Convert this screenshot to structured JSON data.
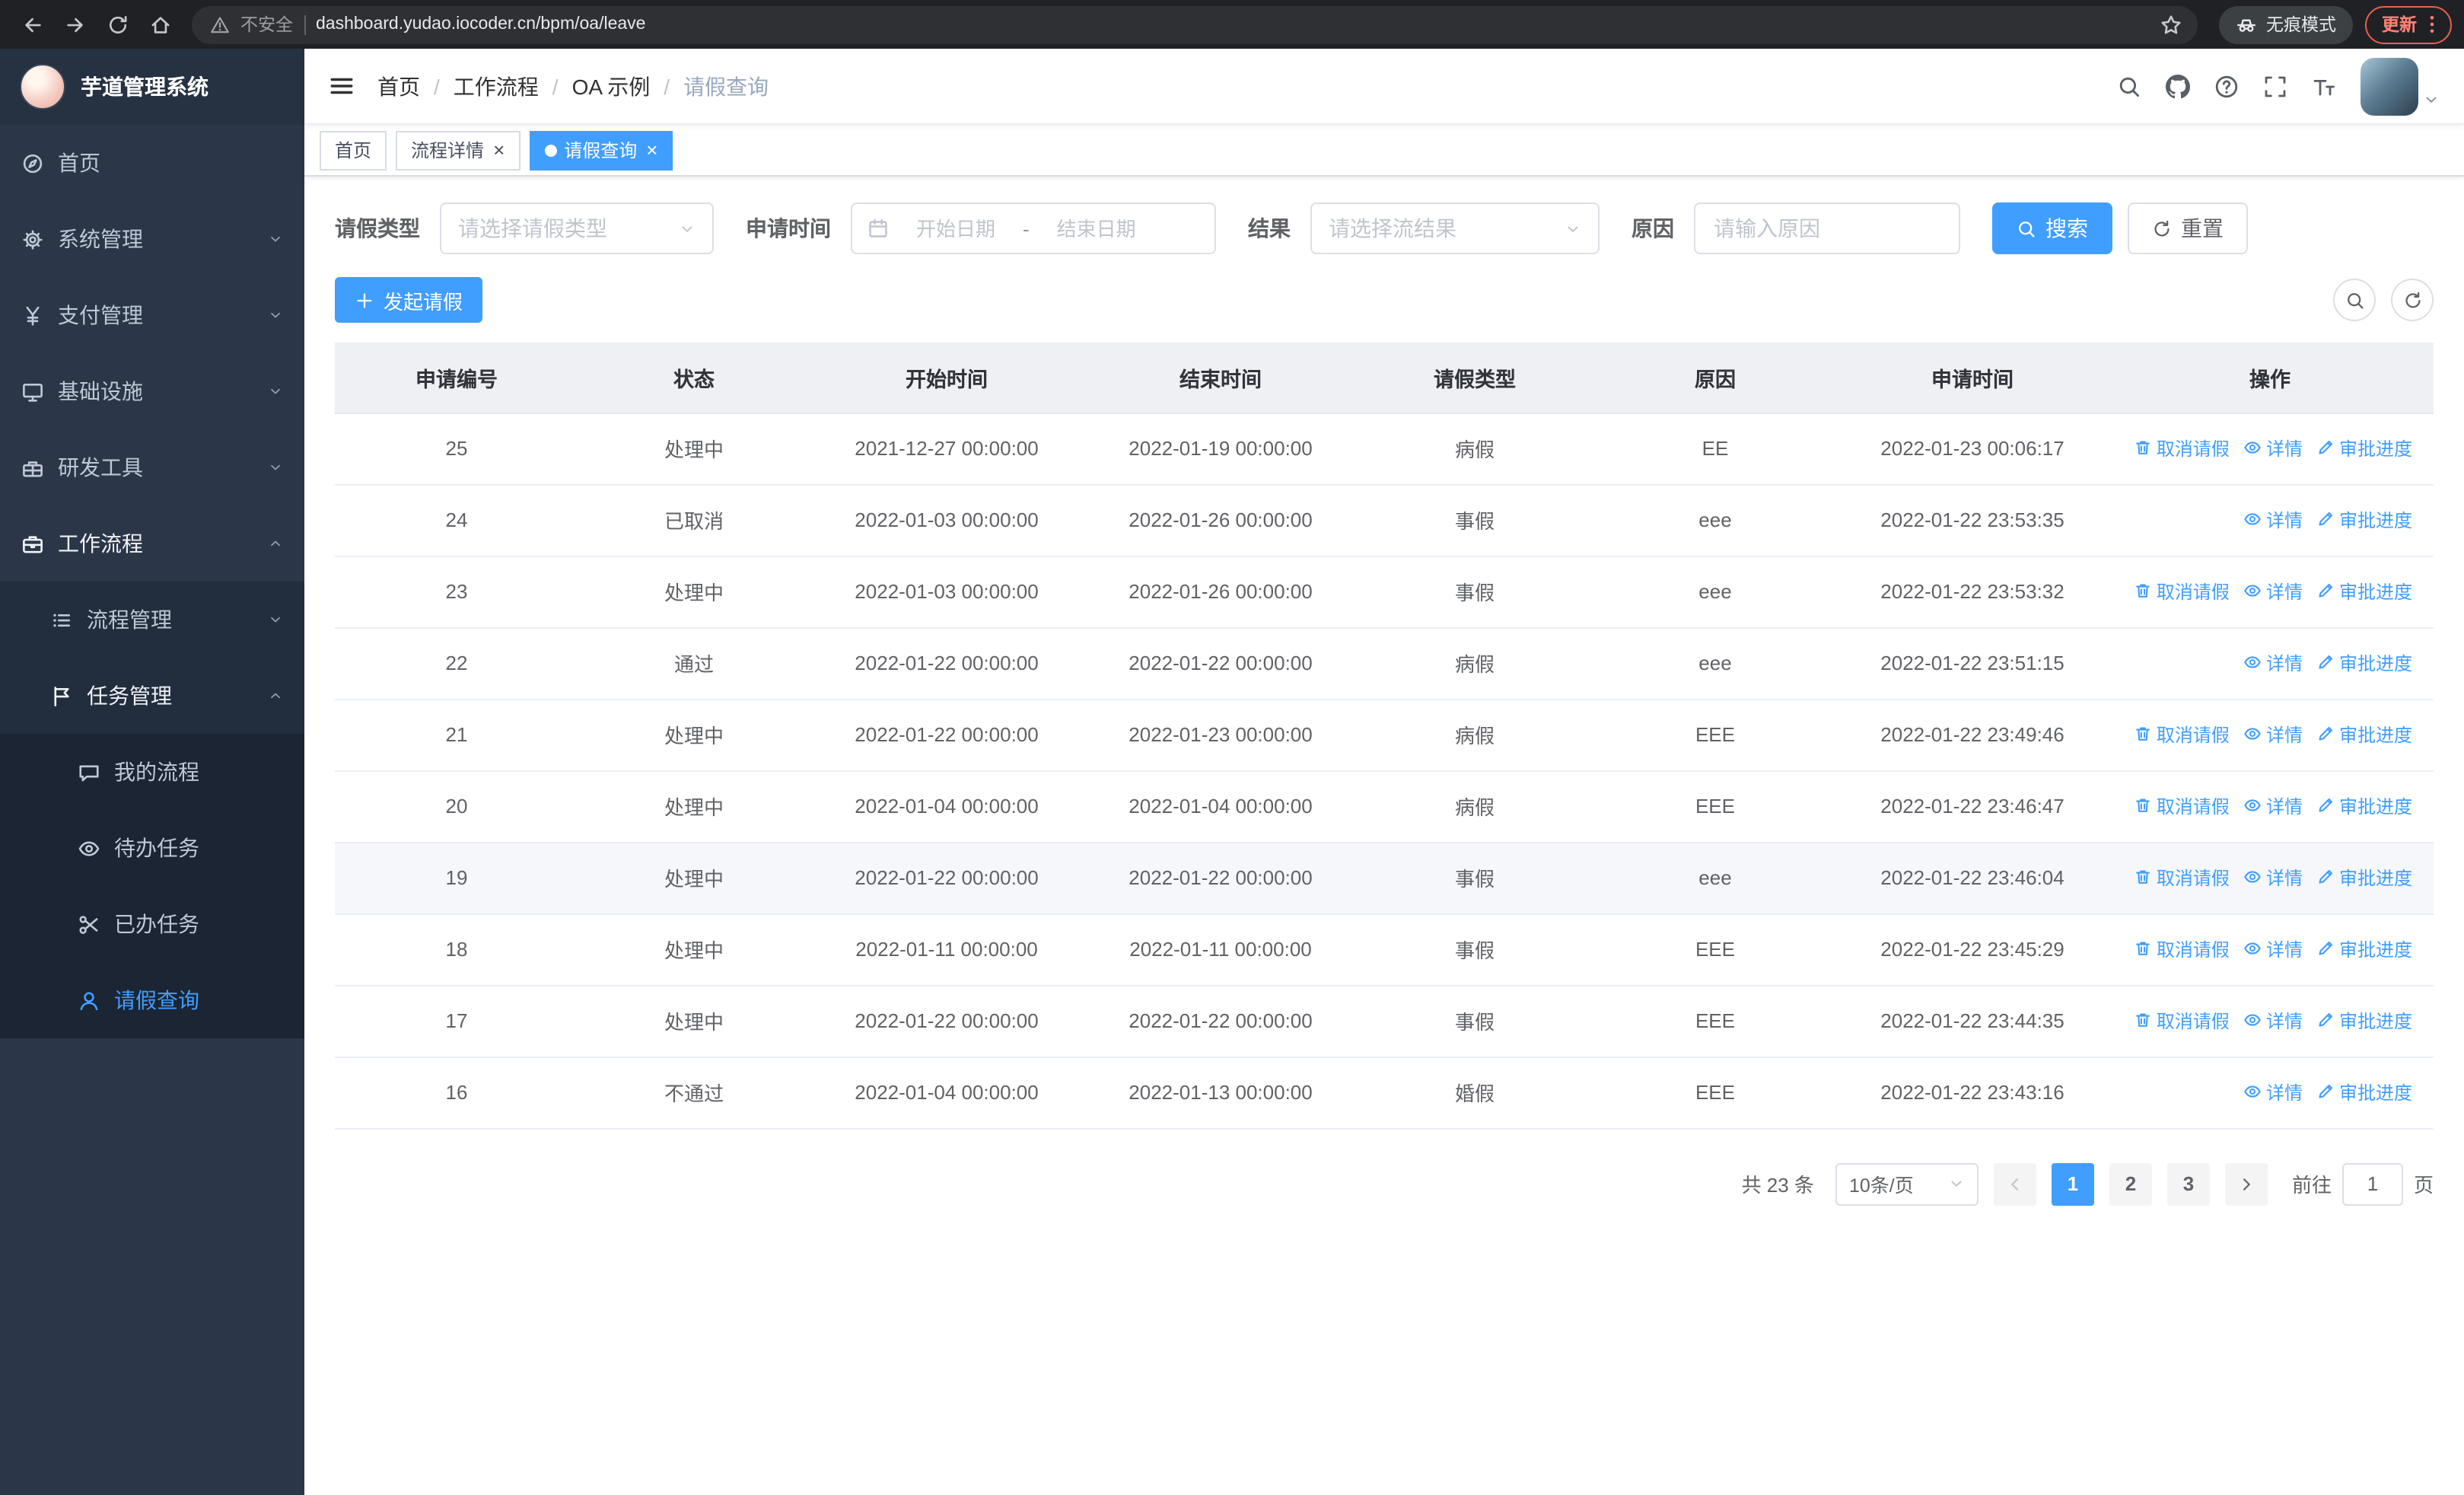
{
  "colors": {
    "accent": "#409eff",
    "sidebar_bg": "#2b3648",
    "table_header_bg": "#eef0f4"
  },
  "browser": {
    "security_label": "不安全",
    "url": "dashboard.yudao.iocoder.cn/bpm/oa/leave",
    "incognito_label": "无痕模式",
    "update_label": "更新"
  },
  "sidebar": {
    "logo_title": "芋道管理系统",
    "items": [
      {
        "label": "首页",
        "icon": "dashboard-icon",
        "level": 1
      },
      {
        "label": "系统管理",
        "icon": "gear-icon",
        "level": 1,
        "chevron": "down"
      },
      {
        "label": "支付管理",
        "icon": "yen-icon",
        "level": 1,
        "chevron": "down"
      },
      {
        "label": "基础设施",
        "icon": "monitor-icon",
        "level": 1,
        "chevron": "down"
      },
      {
        "label": "研发工具",
        "icon": "toolbox-icon",
        "level": 1,
        "chevron": "down"
      },
      {
        "label": "工作流程",
        "icon": "briefcase-icon",
        "level": 1,
        "chevron": "up"
      },
      {
        "label": "流程管理",
        "icon": "list-icon",
        "level": 2,
        "chevron": "down"
      },
      {
        "label": "任务管理",
        "icon": "flag-icon",
        "level": 2,
        "chevron": "up"
      },
      {
        "label": "我的流程",
        "icon": "message-icon",
        "level": 3
      },
      {
        "label": "待办任务",
        "icon": "eye-icon",
        "level": 3
      },
      {
        "label": "已办任务",
        "icon": "scissors-icon",
        "level": 3
      },
      {
        "label": "请假查询",
        "icon": "user-icon",
        "level": 3,
        "active": true
      }
    ]
  },
  "header": {
    "breadcrumb": [
      "首页",
      "工作流程",
      "OA 示例",
      "请假查询"
    ],
    "separator": "/"
  },
  "tabs": [
    {
      "label": "首页",
      "closable": false,
      "active": false
    },
    {
      "label": "流程详情",
      "closable": true,
      "active": false
    },
    {
      "label": "请假查询",
      "closable": true,
      "active": true
    }
  ],
  "filters": {
    "leave_type": {
      "label": "请假类型",
      "placeholder": "请选择请假类型"
    },
    "apply_time": {
      "label": "申请时间",
      "start_placeholder": "开始日期",
      "separator": "-",
      "end_placeholder": "结束日期"
    },
    "result": {
      "label": "结果",
      "placeholder": "请选择流结果"
    },
    "reason": {
      "label": "原因",
      "placeholder": "请输入原因"
    },
    "search_label": "搜索",
    "reset_label": "重置"
  },
  "toolbar": {
    "create_label": "发起请假"
  },
  "table": {
    "columns": [
      "申请编号",
      "状态",
      "开始时间",
      "结束时间",
      "请假类型",
      "原因",
      "申请时间",
      "操作"
    ],
    "action_labels": {
      "cancel": "取消请假",
      "detail": "详情",
      "progress": "审批进度"
    },
    "rows": [
      {
        "id": "25",
        "status": "处理中",
        "start_time": "2021-12-27 00:00:00",
        "end_time": "2022-01-19 00:00:00",
        "leave_type": "病假",
        "reason": "EE",
        "apply_time": "2022-01-23 00:06:17",
        "cancellable": true,
        "hover": false
      },
      {
        "id": "24",
        "status": "已取消",
        "start_time": "2022-01-03 00:00:00",
        "end_time": "2022-01-26 00:00:00",
        "leave_type": "事假",
        "reason": "eee",
        "apply_time": "2022-01-22 23:53:35",
        "cancellable": false,
        "hover": false
      },
      {
        "id": "23",
        "status": "处理中",
        "start_time": "2022-01-03 00:00:00",
        "end_time": "2022-01-26 00:00:00",
        "leave_type": "事假",
        "reason": "eee",
        "apply_time": "2022-01-22 23:53:32",
        "cancellable": true,
        "hover": false
      },
      {
        "id": "22",
        "status": "通过",
        "start_time": "2022-01-22 00:00:00",
        "end_time": "2022-01-22 00:00:00",
        "leave_type": "病假",
        "reason": "eee",
        "apply_time": "2022-01-22 23:51:15",
        "cancellable": false,
        "hover": false
      },
      {
        "id": "21",
        "status": "处理中",
        "start_time": "2022-01-22 00:00:00",
        "end_time": "2022-01-23 00:00:00",
        "leave_type": "病假",
        "reason": "EEE",
        "apply_time": "2022-01-22 23:49:46",
        "cancellable": true,
        "hover": false
      },
      {
        "id": "20",
        "status": "处理中",
        "start_time": "2022-01-04 00:00:00",
        "end_time": "2022-01-04 00:00:00",
        "leave_type": "病假",
        "reason": "EEE",
        "apply_time": "2022-01-22 23:46:47",
        "cancellable": true,
        "hover": false
      },
      {
        "id": "19",
        "status": "处理中",
        "start_time": "2022-01-22 00:00:00",
        "end_time": "2022-01-22 00:00:00",
        "leave_type": "事假",
        "reason": "eee",
        "apply_time": "2022-01-22 23:46:04",
        "cancellable": true,
        "hover": true
      },
      {
        "id": "18",
        "status": "处理中",
        "start_time": "2022-01-11 00:00:00",
        "end_time": "2022-01-11 00:00:00",
        "leave_type": "事假",
        "reason": "EEE",
        "apply_time": "2022-01-22 23:45:29",
        "cancellable": true,
        "hover": false
      },
      {
        "id": "17",
        "status": "处理中",
        "start_time": "2022-01-22 00:00:00",
        "end_time": "2022-01-22 00:00:00",
        "leave_type": "事假",
        "reason": "EEE",
        "apply_time": "2022-01-22 23:44:35",
        "cancellable": true,
        "hover": false
      },
      {
        "id": "16",
        "status": "不通过",
        "start_time": "2022-01-04 00:00:00",
        "end_time": "2022-01-13 00:00:00",
        "leave_type": "婚假",
        "reason": "EEE",
        "apply_time": "2022-01-22 23:43:16",
        "cancellable": false,
        "hover": false
      }
    ]
  },
  "pagination": {
    "total_label": "共 23 条",
    "page_size_label": "10条/页",
    "pages": [
      "1",
      "2",
      "3"
    ],
    "active_page": "1",
    "goto_label": "前往",
    "goto_value": "1",
    "page_unit_label": "页"
  }
}
